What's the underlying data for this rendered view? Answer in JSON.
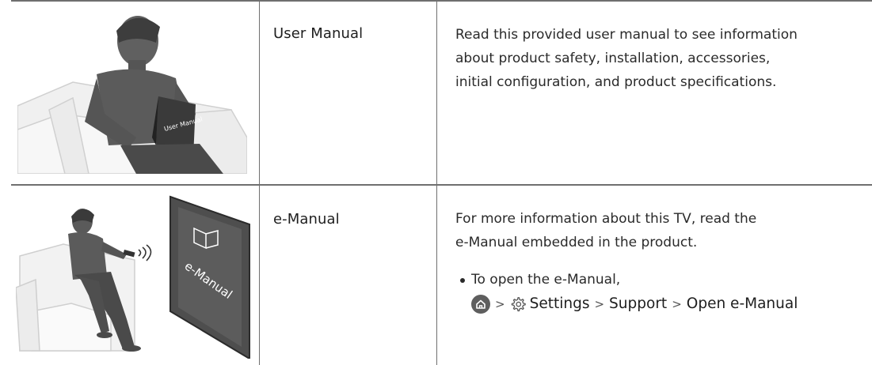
{
  "rows": [
    {
      "title": "User Manual",
      "description": [
        "Read this provided user manual to see information",
        "about product safety, installation, accessories,",
        "initial configuration, and product specifications."
      ],
      "illustration": "person-reading-user-manual",
      "book_label": "User Manual"
    },
    {
      "title": "e-Manual",
      "description": [
        "For more information about this TV, read the",
        "e-Manual embedded in the product."
      ],
      "bullet": "To open the e-Manual,",
      "path": {
        "home_icon": "home-icon",
        "separator": ">",
        "settings_icon": "gear-icon",
        "settings": "Settings",
        "support": "Support",
        "open": "Open e-Manual"
      },
      "illustration": "person-using-remote-with-tv",
      "tv_label": "e-Manual"
    }
  ],
  "colors": {
    "rule": "#6f6f6f",
    "illustration_gray": "#5a5a5a",
    "light_gray": "#e6e6e6"
  }
}
